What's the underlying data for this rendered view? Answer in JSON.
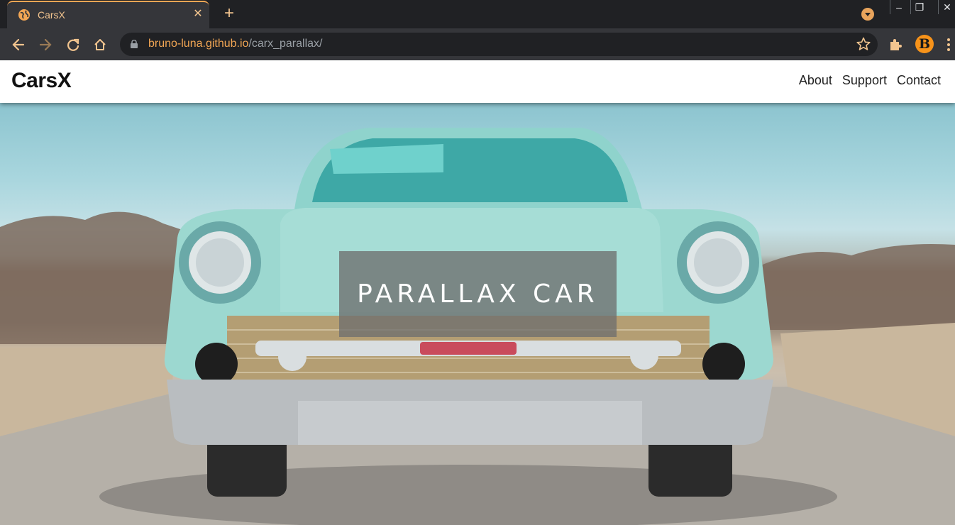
{
  "browser": {
    "tab_title": "CarsX",
    "tab_close_icon": "close-icon",
    "new_tab_icon": "plus-icon",
    "url_host": "bruno-luna.github.io",
    "url_path": "/carx_parallax/",
    "extension_badge": "B"
  },
  "site": {
    "brand": "CarsX",
    "nav": [
      "About",
      "Support",
      "Contact"
    ],
    "hero_title": "PARALLAX CAR"
  },
  "colors": {
    "accent": "#f2a654",
    "navbar_bg": "#ffffff",
    "hero_overlay": "#6e6e6e"
  }
}
